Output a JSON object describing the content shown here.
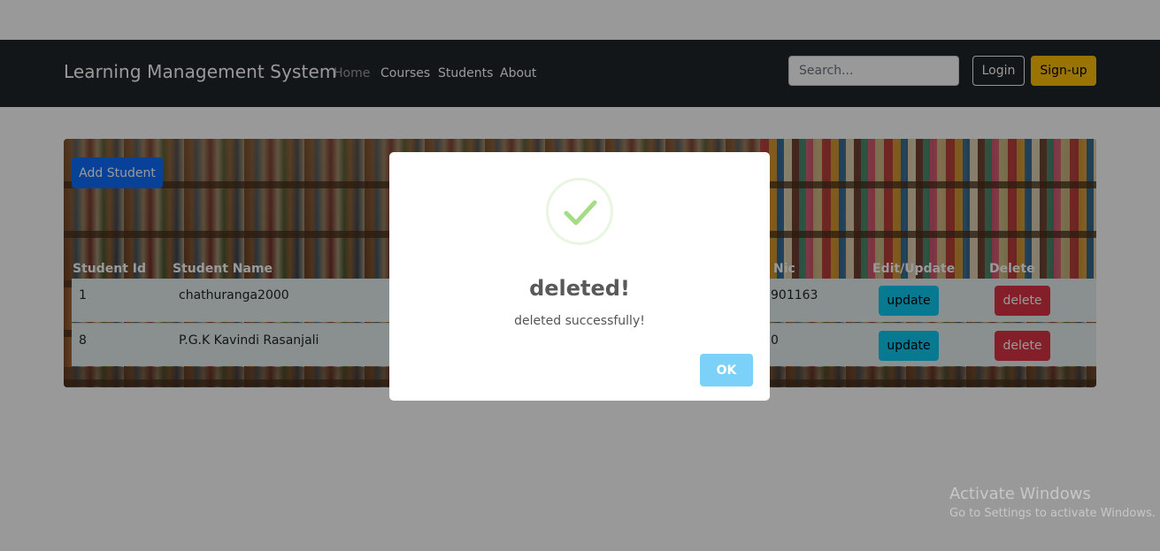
{
  "navbar": {
    "brand": "Learning Management System",
    "links": [
      "Home",
      "Courses",
      "Students",
      "About"
    ],
    "search_placeholder": "Search...",
    "login_label": "Login",
    "signup_label": "Sign-up"
  },
  "panel": {
    "add_label": "Add Student",
    "headers": {
      "id": "Student Id",
      "name": "Student Name",
      "nic": "Nic",
      "edit": "Edit/Update",
      "delete": "Delete"
    },
    "rows": [
      {
        "id": "1",
        "name": "chathuranga2000",
        "nic": "901163",
        "update": "update",
        "delete": "delete"
      },
      {
        "id": "8",
        "name": "P.G.K Kavindi Rasanjali",
        "nic": "0",
        "update": "update",
        "delete": "delete"
      }
    ]
  },
  "dialog": {
    "title": "deleted!",
    "message": "deleted successfully!",
    "ok_label": "OK",
    "icon": "success-check-icon",
    "icon_color": "#a5dc86",
    "ok_color": "#7cd1f9"
  },
  "watermark": {
    "line1": "Activate Windows",
    "line2": "Go to Settings to activate Windows."
  }
}
